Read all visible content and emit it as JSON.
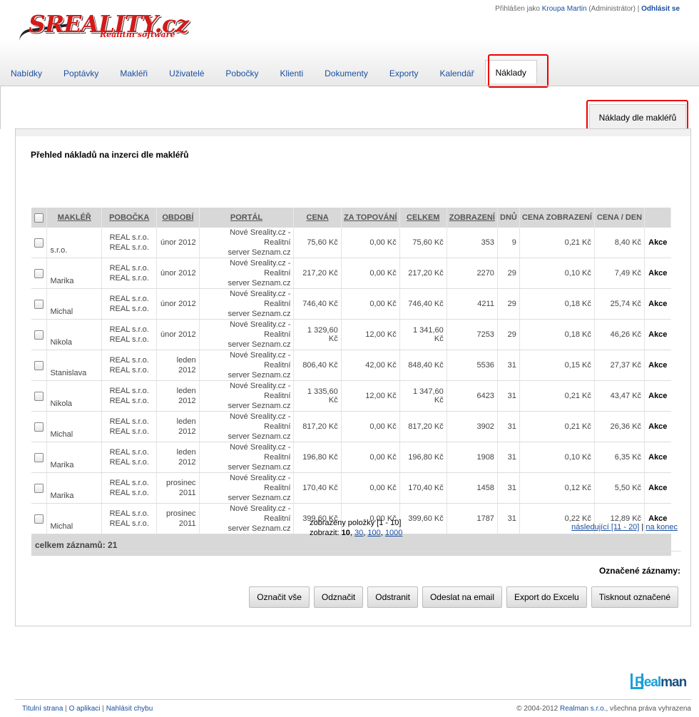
{
  "brand": {
    "name": "SREALITY.cz",
    "tagline": "Realitní software"
  },
  "userbar": {
    "prefix": "Přihlášen jako",
    "user": "Kroupa Martin",
    "role": "(Administrátor)",
    "sep": "|",
    "logout": "Odhlásit se"
  },
  "nav": [
    {
      "label": "Nabídky"
    },
    {
      "label": "Poptávky"
    },
    {
      "label": "Makléři"
    },
    {
      "label": "Uživatelé"
    },
    {
      "label": "Pobočky"
    },
    {
      "label": "Klienti"
    },
    {
      "label": "Dokumenty"
    },
    {
      "label": "Exporty"
    },
    {
      "label": "Kalendář"
    },
    {
      "label": "Náklady",
      "active": true
    }
  ],
  "subtab": {
    "label": "Náklady dle makléřů"
  },
  "page": {
    "title": "Přehled nákladů na inzerci dle makléřů"
  },
  "table": {
    "headers": {
      "makler": "MAKLÉŘ",
      "pobocka": "POBOČKA",
      "obdobi": "OBDOBÍ",
      "portal": "PORTÁL",
      "cena": "CENA",
      "top": "ZA TOPOVÁNÍ",
      "celkem": "CELKEM",
      "zobrazeni": "ZOBRAZENÍ",
      "dnu": "DNŮ",
      "cena_zobr": "CENA ZOBRAZENÍ",
      "cena_den": "CENA / DEN"
    },
    "rows": [
      {
        "makler": "s.r.o.",
        "pob1": "REAL s.r.o.",
        "pob2": "REAL s.r.o.",
        "obd1": "únor 2012",
        "obd2": "",
        "por1": "Nové Sreality.cz - Realitní",
        "por2": "server Seznam.cz",
        "cena": "75,60 Kč",
        "top": "0,00 Kč",
        "celkem": "75,60 Kč",
        "zobr": "353",
        "dnu": "9",
        "cz": "0,21 Kč",
        "cd": "8,40 Kč",
        "akce": "Akce"
      },
      {
        "makler": "Marika",
        "pob1": "REAL s.r.o.",
        "pob2": "REAL s.r.o.",
        "obd1": "únor 2012",
        "obd2": "",
        "por1": "Nové Sreality.cz - Realitní",
        "por2": "server Seznam.cz",
        "cena": "217,20 Kč",
        "top": "0,00 Kč",
        "celkem": "217,20 Kč",
        "zobr": "2270",
        "dnu": "29",
        "cz": "0,10 Kč",
        "cd": "7,49 Kč",
        "akce": "Akce"
      },
      {
        "makler": "Michal",
        "pob1": "REAL s.r.o.",
        "pob2": "REAL s.r.o.",
        "obd1": "únor 2012",
        "obd2": "",
        "por1": "Nové Sreality.cz - Realitní",
        "por2": "server Seznam.cz",
        "cena": "746,40 Kč",
        "top": "0,00 Kč",
        "celkem": "746,40 Kč",
        "zobr": "4211",
        "dnu": "29",
        "cz": "0,18 Kč",
        "cd": "25,74 Kč",
        "akce": "Akce"
      },
      {
        "makler": "Nikola",
        "pob1": "REAL s.r.o.",
        "pob2": "REAL s.r.o.",
        "obd1": "únor 2012",
        "obd2": "",
        "por1": "Nové Sreality.cz - Realitní",
        "por2": "server Seznam.cz",
        "cena": "1 329,60 Kč",
        "top": "12,00 Kč",
        "celkem": "1 341,60 Kč",
        "zobr": "7253",
        "dnu": "29",
        "cz": "0,18 Kč",
        "cd": "46,26 Kč",
        "akce": "Akce"
      },
      {
        "makler": "Stanislava",
        "pob1": "REAL s.r.o.",
        "pob2": "REAL s.r.o.",
        "obd1": "leden",
        "obd2": "2012",
        "por1": "Nové Sreality.cz - Realitní",
        "por2": "server Seznam.cz",
        "cena": "806,40 Kč",
        "top": "42,00 Kč",
        "celkem": "848,40 Kč",
        "zobr": "5536",
        "dnu": "31",
        "cz": "0,15 Kč",
        "cd": "27,37 Kč",
        "akce": "Akce"
      },
      {
        "makler": "Nikola",
        "pob1": "REAL s.r.o.",
        "pob2": "REAL s.r.o.",
        "obd1": "leden",
        "obd2": "2012",
        "por1": "Nové Sreality.cz - Realitní",
        "por2": "server Seznam.cz",
        "cena": "1 335,60 Kč",
        "top": "12,00 Kč",
        "celkem": "1 347,60 Kč",
        "zobr": "6423",
        "dnu": "31",
        "cz": "0,21 Kč",
        "cd": "43,47 Kč",
        "akce": "Akce"
      },
      {
        "makler": "Michal",
        "pob1": "REAL s.r.o.",
        "pob2": "REAL s.r.o.",
        "obd1": "leden",
        "obd2": "2012",
        "por1": "Nové Sreality.cz - Realitní",
        "por2": "server Seznam.cz",
        "cena": "817,20 Kč",
        "top": "0,00 Kč",
        "celkem": "817,20 Kč",
        "zobr": "3902",
        "dnu": "31",
        "cz": "0,21 Kč",
        "cd": "26,36 Kč",
        "akce": "Akce"
      },
      {
        "makler": "Marika",
        "pob1": "REAL s.r.o.",
        "pob2": "REAL s.r.o.",
        "obd1": "leden",
        "obd2": "2012",
        "por1": "Nové Sreality.cz - Realitní",
        "por2": "server Seznam.cz",
        "cena": "196,80 Kč",
        "top": "0,00 Kč",
        "celkem": "196,80 Kč",
        "zobr": "1908",
        "dnu": "31",
        "cz": "0,10 Kč",
        "cd": "6,35 Kč",
        "akce": "Akce"
      },
      {
        "makler": "Marika",
        "pob1": "REAL s.r.o.",
        "pob2": "REAL s.r.o.",
        "obd1": "prosinec",
        "obd2": "2011",
        "por1": "Nové Sreality.cz - Realitní",
        "por2": "server Seznam.cz",
        "cena": "170,40 Kč",
        "top": "0,00 Kč",
        "celkem": "170,40 Kč",
        "zobr": "1458",
        "dnu": "31",
        "cz": "0,12 Kč",
        "cd": "5,50 Kč",
        "akce": "Akce"
      },
      {
        "makler": "Michal",
        "pob1": "REAL s.r.o.",
        "pob2": "REAL s.r.o.",
        "obd1": "prosinec",
        "obd2": "2011",
        "por1": "Nové Sreality.cz - Realitní",
        "por2": "server Seznam.cz",
        "cena": "399,60 Kč",
        "top": "0,00 Kč",
        "celkem": "399,60 Kč",
        "zobr": "1787",
        "dnu": "31",
        "cz": "0,22 Kč",
        "cd": "12,89 Kč",
        "akce": "Akce"
      }
    ],
    "total": "celkem záznamů: 21"
  },
  "pager": {
    "shown": "zobrazeny položky [1 - 10]",
    "show_label": "zobrazit:",
    "sizes": [
      "10",
      "30",
      "100",
      "1000"
    ],
    "next": "následující [11 - 20]",
    "sep": "|",
    "last": "na konec"
  },
  "bulk": {
    "label": "Označené záznamy:",
    "buttons": [
      "Označit vše",
      "Odznačit",
      "Odstranit",
      "Odeslat na email",
      "Export do Excelu",
      "Tisknout označené"
    ]
  },
  "footer": {
    "links": [
      "Titulní strana",
      "O aplikaci",
      "Nahlásit chybu"
    ],
    "sep": "|",
    "copy_pre": "© 2004-2012",
    "copy_company": "Realman s.r.o.",
    "copy_post": ", všechna práva vyhrazena",
    "logo": {
      "a": "Real",
      "b": "man"
    }
  },
  "colors": {
    "link": "#1a4fa0",
    "brand_red": "#d11a1a",
    "highlight_box": "#ee0000",
    "header_row": "#d8d8d8"
  }
}
